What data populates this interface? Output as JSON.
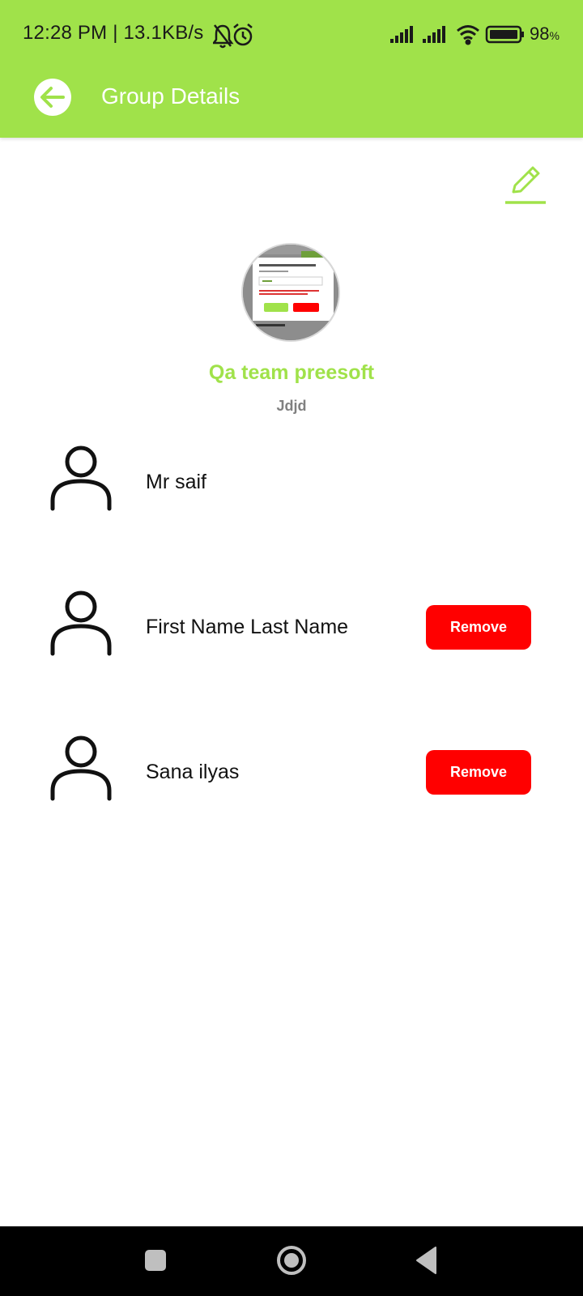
{
  "status_bar": {
    "time": "12:28 PM | 13.1KB/s",
    "battery": "98",
    "battery_unit": "%",
    "icons": [
      "bell-muted-icon",
      "alarm-icon",
      "signal-icon",
      "signal-icon",
      "wifi-icon",
      "battery-icon"
    ]
  },
  "header": {
    "title": "Group Details",
    "back_icon": "arrow-left-icon"
  },
  "actions": {
    "edit_icon": "pencil-icon"
  },
  "group": {
    "name": "Qa team preesoft",
    "description": "Jdjd"
  },
  "members": [
    {
      "name": "Mr saif",
      "removable": false
    },
    {
      "name": "First Name Last Name",
      "removable": true,
      "remove_label": "Remove"
    },
    {
      "name": "Sana ilyas",
      "removable": true,
      "remove_label": "Remove"
    }
  ],
  "nav": {
    "items": [
      "recents-square-icon",
      "home-circle-icon",
      "back-triangle-icon"
    ]
  },
  "colors": {
    "accent": "#a0e24a",
    "danger": "#ff0000",
    "text": "#111111",
    "muted": "#808080"
  }
}
